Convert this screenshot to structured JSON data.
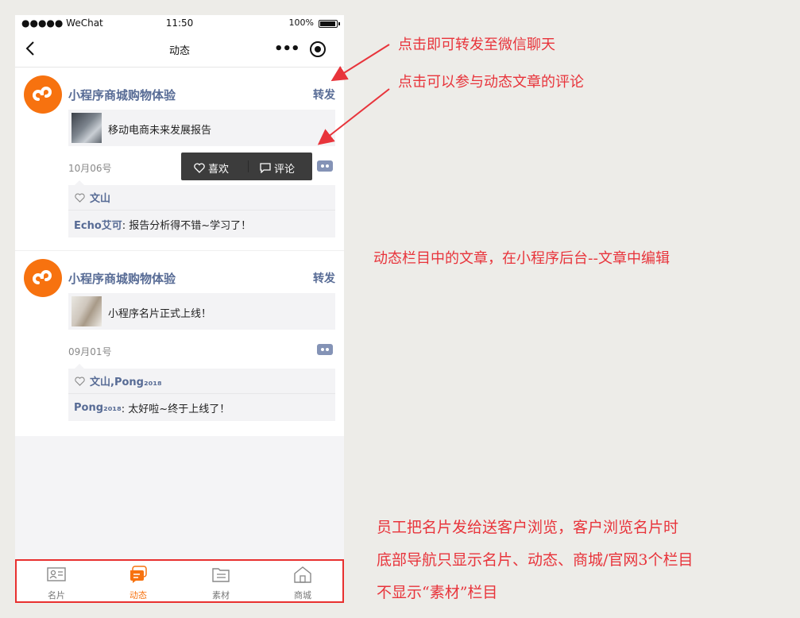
{
  "status_bar": {
    "carrier": "●●●●● WeChat",
    "time": "11:50",
    "battery": "100%"
  },
  "nav": {
    "title": "动态",
    "back_icon": "chevron-left-icon",
    "more_icon": "more-dots-icon",
    "target_icon": "record-target-icon"
  },
  "posts": [
    {
      "author": "小程序商城购物体验",
      "share_label": "转发",
      "article_title": "移动电商未来发展报告",
      "date": "10月06号",
      "likes": "文山",
      "comment_author": "Echo艾可",
      "comment_text": ": 报告分析得不错~学习了！"
    },
    {
      "author": "小程序商城购物体验",
      "share_label": "转发",
      "article_title": "小程序名片正式上线！",
      "date": "09月01号",
      "likes": "文山,Pong₂₀₁₈",
      "comment_author": "Pong₂₀₁₈",
      "comment_text": ": 太好啦~终于上线了！"
    }
  ],
  "popup": {
    "like_label": "喜欢",
    "comment_label": "评论"
  },
  "tabs": [
    {
      "label": "名片",
      "icon": "business-card-icon"
    },
    {
      "label": "动态",
      "icon": "chat-bubble-icon",
      "active": true
    },
    {
      "label": "素材",
      "icon": "folder-icon"
    },
    {
      "label": "商城",
      "icon": "home-icon"
    }
  ],
  "annotations": {
    "share_note": "点击即可转发至微信聊天",
    "comment_note": "点击可以参与动态文章的评论",
    "article_note": "动态栏目中的文章，在小程序后台--文章中编辑",
    "footer_note_1": "员工把名片发给送客户浏览，客户浏览名片时",
    "footer_note_2": "底部导航只显示名片、动态、商城/官网3个栏目",
    "footer_note_3": "不显示“素材”栏目"
  },
  "colors": {
    "accent": "#f7720f",
    "link": "#576b95",
    "annotation": "#e8343b",
    "highlight_frame": "#e8302f"
  }
}
